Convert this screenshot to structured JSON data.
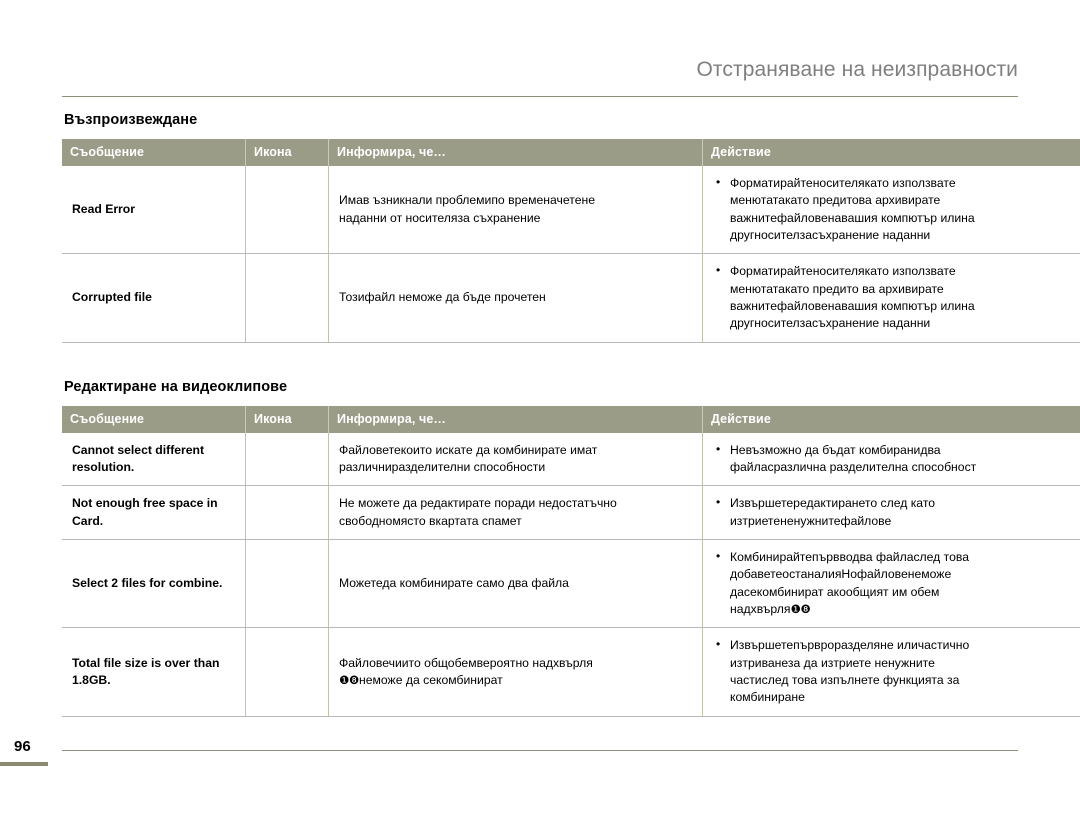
{
  "header": {
    "title": "Отстраняване на неизправности"
  },
  "footer": {
    "page_number": "96"
  },
  "columns": {
    "message": "Съобщение",
    "icon": "Икона",
    "informs": "Информира, че…",
    "action": "Действие"
  },
  "colors": {
    "table_header_bg": "#9b9c87",
    "table_header_text": "#ffffff",
    "rule": "#8d8d7a",
    "header_title": "#7f7f7f",
    "cell_border": "#b9b9b9"
  },
  "sections": [
    {
      "title": "Възпроизвеждане",
      "rows": [
        {
          "message": "Read Error",
          "icon": "",
          "informs": [
            "Имав ъзникнали проблемипо временачетене",
            "наданни от носителяза  съхранение"
          ],
          "action": [
            [
              "Форматирайтеносителякато   използвате",
              "менютатакато  предитова  архивирате",
              "важнитефайловенавашия   компютър илина",
              "другносителзасъхранение   наданни"
            ]
          ]
        },
        {
          "message": "Corrupted file",
          "icon": "",
          "informs": [
            "Тозифайл неможе  да бъде прочетен"
          ],
          "action": [
            [
              "Форматирайтеносителякато   използвате",
              "менютатакато  предито  ва архивирате",
              "важнитефайловенавашия   компютър илина",
              "другносителзасъхранение   наданни"
            ]
          ]
        }
      ]
    },
    {
      "title": "Редактиране на видеоклипове",
      "rows": [
        {
          "message": "Cannot select different resolution.",
          "icon": "",
          "informs": [
            "Файловетекоито  искате да комбинирате имат",
            "различниразделителни способности"
          ],
          "action": [
            [
              "Невъзможно  да бъдат комбиранидва",
              "файласразлична  разделителна способност"
            ]
          ]
        },
        {
          "message": "Not enough free space in Card.",
          "icon": "",
          "informs": [
            "Не можете да редактирате поради недостатъчно",
            "свободномясто вкартата  спамет"
          ],
          "action": [
            [
              "Извършетередактирането след  като",
              "изтриетененужнитефайлове"
            ]
          ]
        },
        {
          "message": "Select 2 files for combine.",
          "icon": "",
          "informs": [
            "Можетеда комбинирате само два  файла"
          ],
          "action": [
            [
              "Комбинирайтепървводва  файласлед  това",
              "добаветеостаналияНофайловенеможе",
              "дасекомбинират  акообщият   им обем",
              "надхвърля❶❽"
            ]
          ]
        },
        {
          "message": "Total file size is over than 1.8GB.",
          "icon": "",
          "informs": [
            "Файловечиито  общобемвероятно   надхвърля",
            "❶❽неможе     да секомбинират"
          ],
          "action": [
            [
              "Извършетепървроразделяне  иличастично",
              "изтриванеза  да изтриете ненужните",
              "частислед  това изпълнете функцията за",
              "комбиниране"
            ]
          ]
        }
      ]
    }
  ]
}
